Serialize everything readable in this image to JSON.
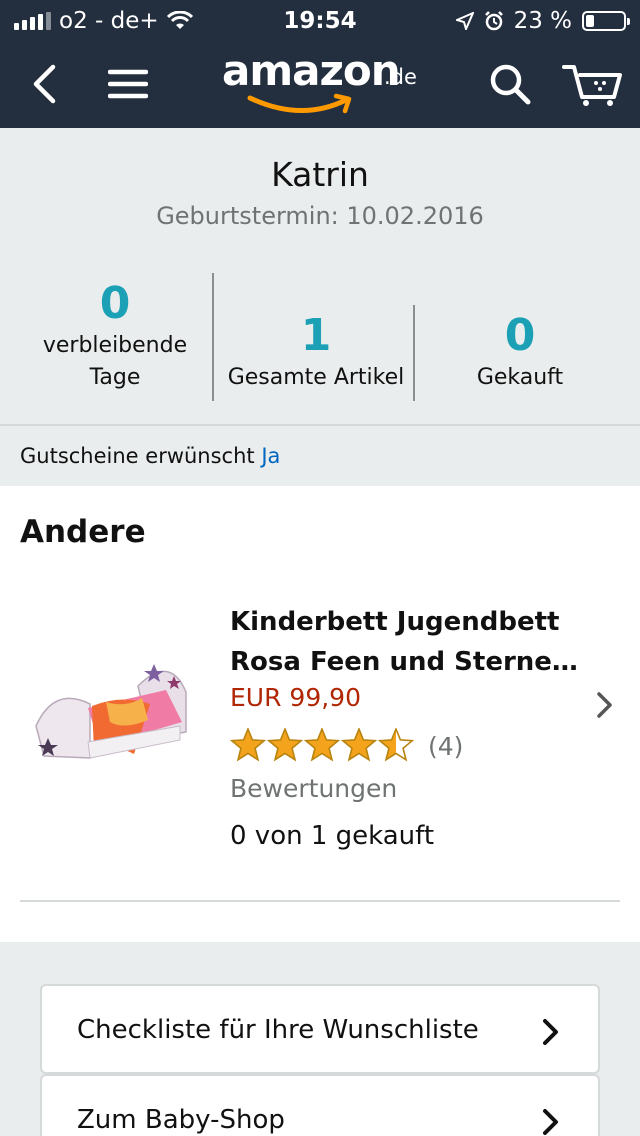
{
  "status_bar": {
    "carrier": "o2 - de+",
    "time": "19:54",
    "battery": "23 %",
    "battery_level": 0.23
  },
  "nav": {
    "logo_main": "amazon",
    "logo_tld": ".de",
    "icons": [
      "back-arrow-icon",
      "hamburger-menu-icon",
      "search-icon",
      "cart-icon"
    ]
  },
  "profile": {
    "name": "Katrin",
    "due_date": "Geburtstermin: 10.02.2016",
    "stats": [
      {
        "value": "0",
        "label": "verbleibende Tage"
      },
      {
        "value": "1",
        "label": "Gesamte Artikel"
      },
      {
        "value": "0",
        "label": "Gekauft"
      }
    ],
    "voucher_label": "Gutscheine erwünscht",
    "voucher_value": "Ja"
  },
  "list": {
    "section_title": "Andere",
    "items": [
      {
        "title": "Kinderbett Jugendbett Rosa Feen und Sterne…",
        "price": "EUR 99,90",
        "rating": 4.5,
        "reviews": "(4) Bewertungen",
        "purchased": "0 von 1 gekauft"
      }
    ]
  },
  "links": [
    {
      "label": "Checkliste für Ihre Wunschliste"
    },
    {
      "label": "Zum Baby-Shop"
    }
  ],
  "colors": {
    "header_bg": "#232f3e",
    "accent_teal": "#1ba0b5",
    "price_red": "#b12704",
    "link_blue": "#0066c0",
    "star_gold": "#f4a41c",
    "logo_smile": "#ff9900"
  }
}
